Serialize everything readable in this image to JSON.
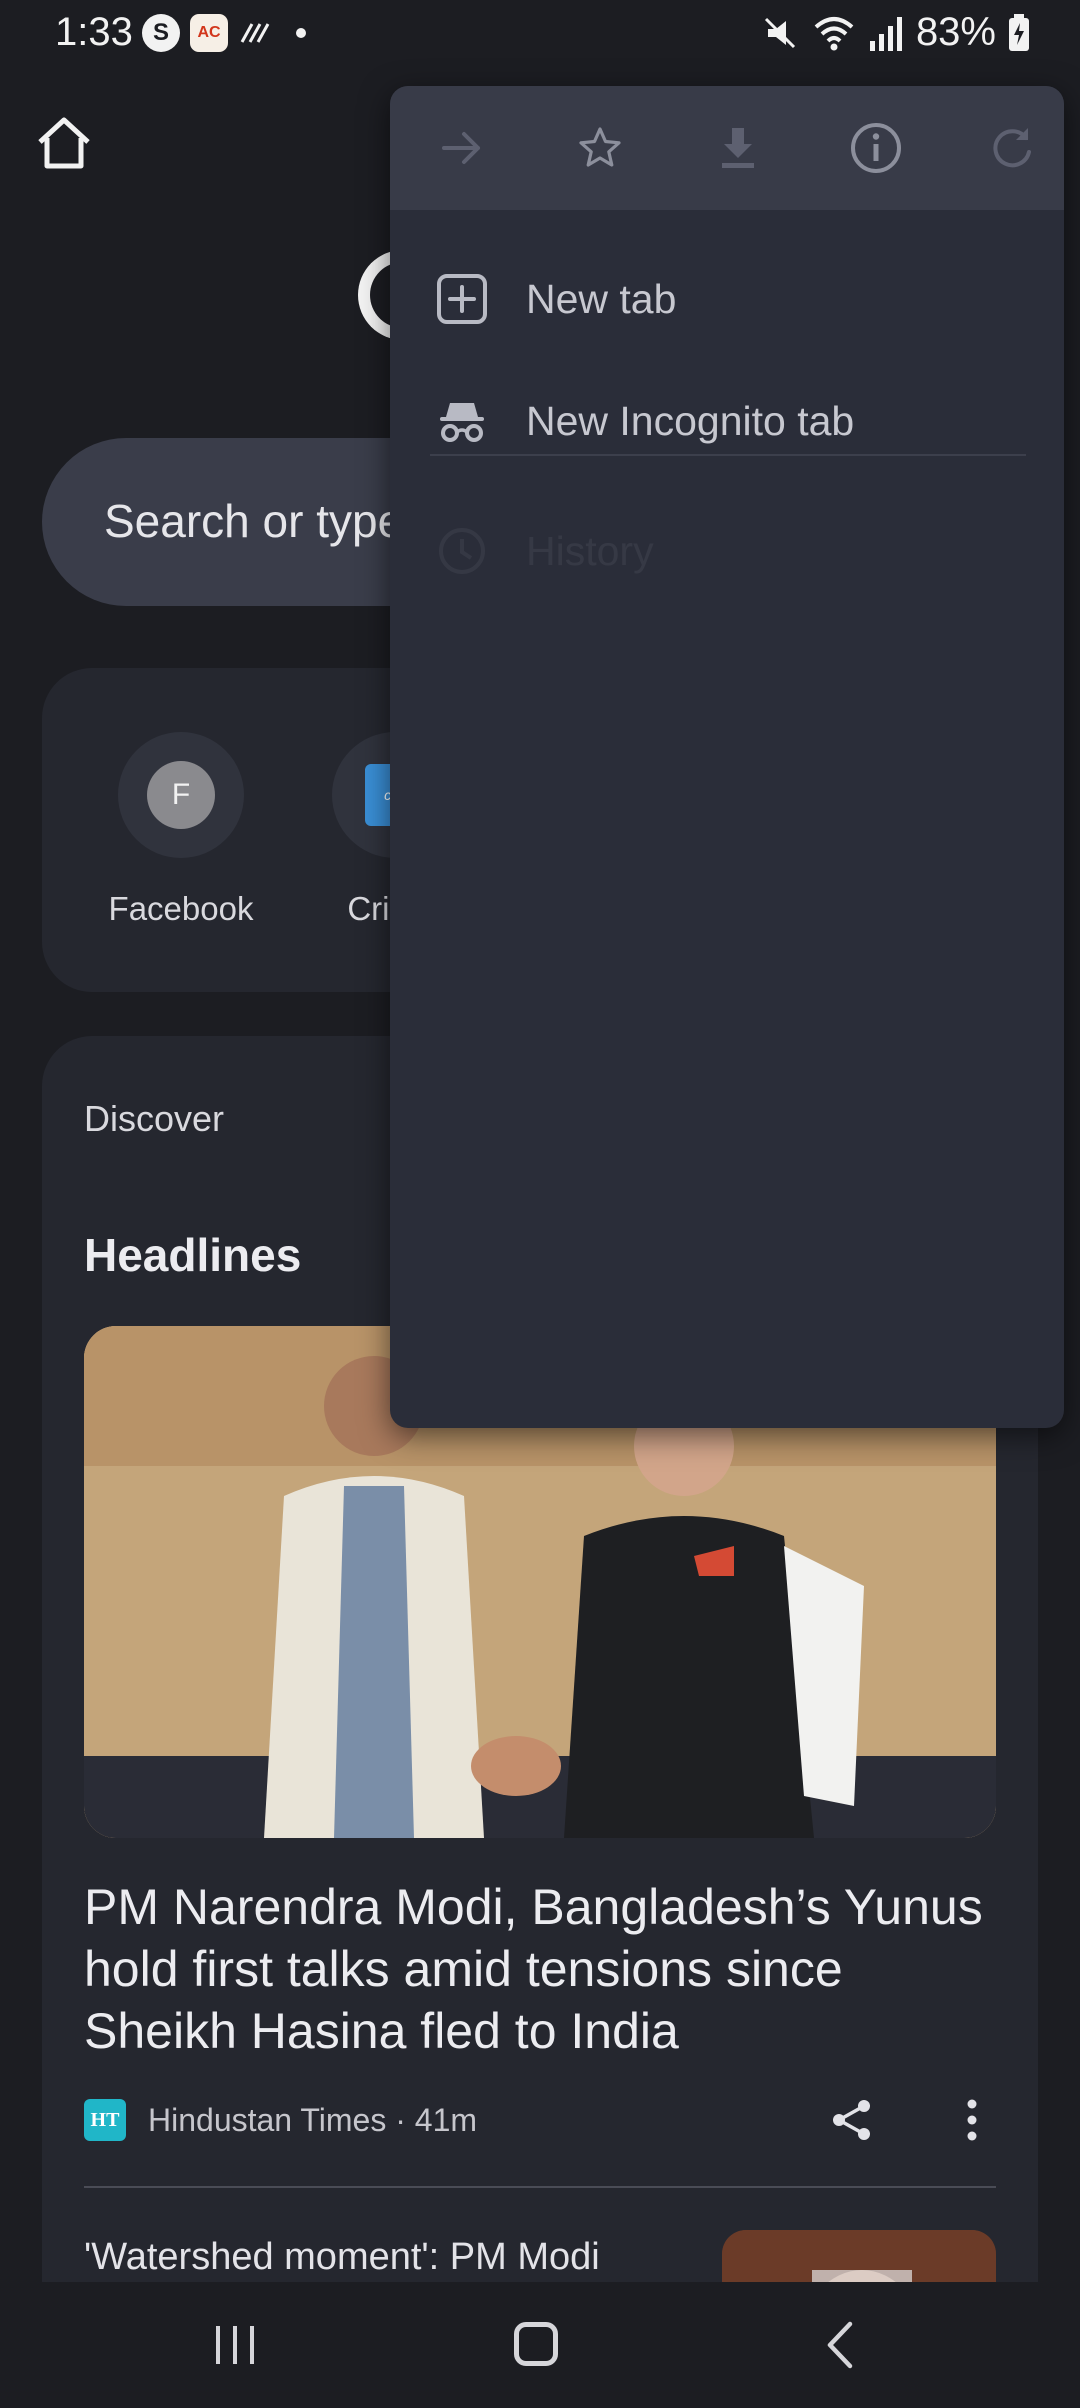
{
  "status_bar": {
    "time": "1:33",
    "app_badge_s": "S",
    "app_badge_other": "AC",
    "battery": "83%",
    "icons": [
      "mute-icon",
      "wifi-icon",
      "signal-icon",
      "battery-icon"
    ]
  },
  "search": {
    "placeholder": "Search or type"
  },
  "shortcuts": [
    {
      "label": "Facebook",
      "letter": "F"
    },
    {
      "label": "Cricbu",
      "letter": "cric"
    }
  ],
  "discover": {
    "title": "Discover",
    "section": "Headlines",
    "article": {
      "title": "PM Narendra Modi, Bangladesh’s Yunus hold first talks amid tensions since Sheikh Hasina fled to India",
      "source_logo": "HT",
      "source": "Hindustan Times · 41m"
    },
    "next_article": {
      "title": "'Watershed moment': PM Modi"
    }
  },
  "menu": {
    "toolbar": [
      "forward-icon",
      "bookmark-star-icon",
      "download-icon",
      "info-icon",
      "refresh-icon"
    ],
    "items": [
      {
        "label": "New tab",
        "icon": "new-tab-icon"
      },
      {
        "label": "New Incognito tab",
        "icon": "incognito-icon"
      },
      {
        "label": "History",
        "icon": "history-icon"
      }
    ]
  },
  "colors": {
    "background": "#1c1d22",
    "card": "#25272f",
    "search_pill": "#3a3d4a",
    "menu": "#2a2d39",
    "menu_toolbar": "#383b48",
    "ht_logo": "#20b6c8"
  }
}
